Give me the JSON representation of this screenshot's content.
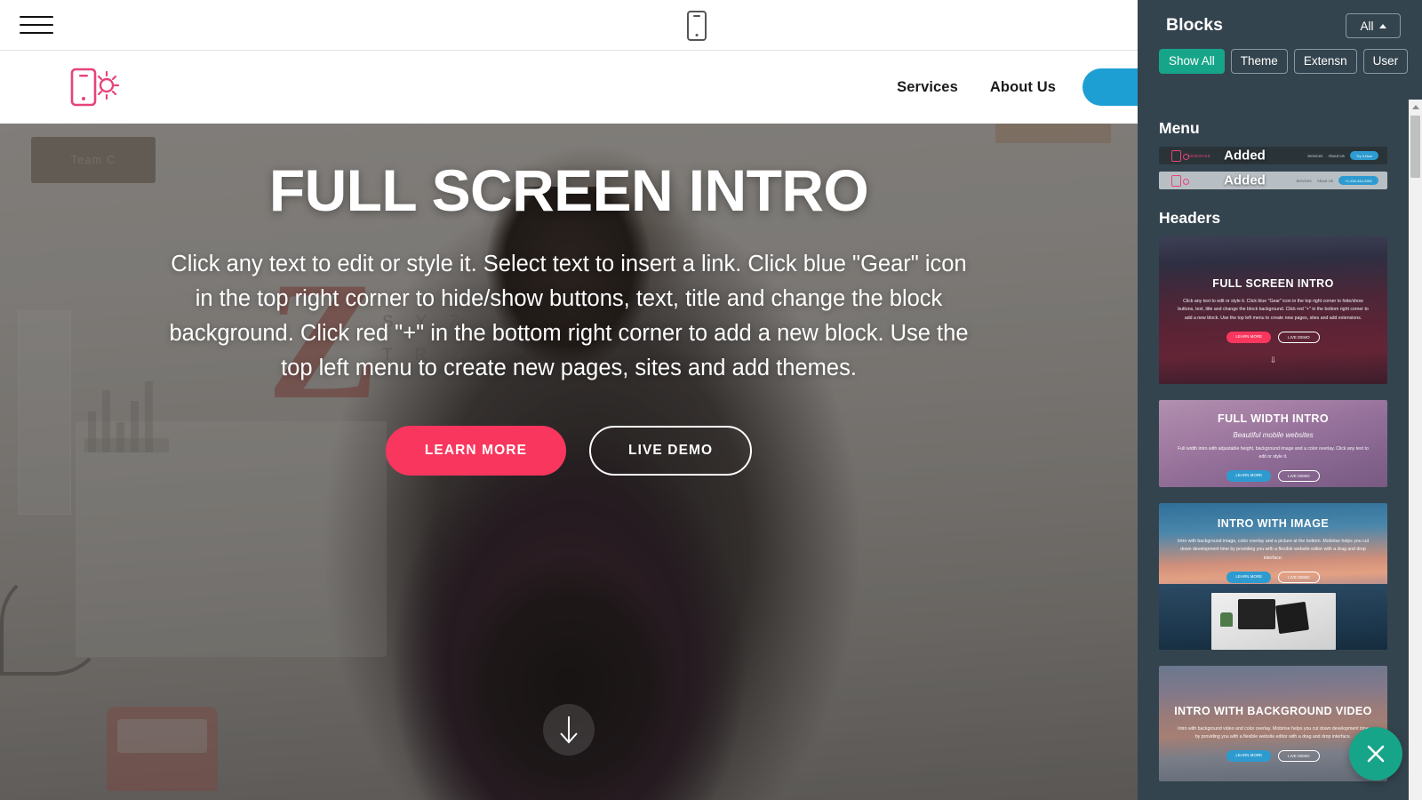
{
  "toolbar": {
    "menu_icon": "hamburger-menu-icon",
    "device_icon": "mobile-device-icon"
  },
  "site_navbar": {
    "logo_icon": "mobirise-phone-sun-logo",
    "links": [
      {
        "label": "Services"
      },
      {
        "label": "About Us"
      }
    ],
    "cta_color": "#1e9fd4"
  },
  "hero": {
    "title": "FULL SCREEN INTRO",
    "subtitle": "Click any text to edit or style it. Select text to insert a link. Click blue \"Gear\" icon in the top right corner to hide/show buttons, text, title and change the block background. Click red \"+\" in the bottom right corner to add a new block. Use the top left menu to create new pages, sites and add themes.",
    "buttons": [
      {
        "label": "LEARN MORE",
        "color": "#f8365e"
      },
      {
        "label": "LIVE DEMO",
        "color": "#ffffff"
      }
    ],
    "scroll_icon": "arrow-down-icon",
    "bg_letter": "Z",
    "bg_letters": "S Y Z I T R O",
    "bg_board_label": "Team C"
  },
  "panel": {
    "title": "Blocks",
    "filter": {
      "label": "All",
      "icon": "caret-up-icon"
    },
    "tabs": [
      {
        "label": "Show All",
        "active": true
      },
      {
        "label": "Theme",
        "active": false
      },
      {
        "label": "Extensn",
        "active": false
      },
      {
        "label": "User",
        "active": false
      }
    ],
    "accent_color": "#17a589",
    "background_color": "#34444e",
    "sections": [
      {
        "title": "Menu",
        "items": [
          {
            "status": "Added",
            "theme": "dark",
            "brand": "MOBIRISE",
            "links": [
              "Services",
              "About Us"
            ],
            "button": "Try It Now"
          },
          {
            "status": "Added",
            "theme": "light",
            "brand": "",
            "links": [
              "Services",
              "About Us"
            ],
            "button": "+1-234-444-2901"
          }
        ]
      },
      {
        "title": "Headers",
        "items": [
          {
            "title": "FULL SCREEN INTRO",
            "subtitle": "",
            "text": "Click any text to edit or style it. Click blue \"Gear\" icon in the top right corner to hide/show buttons, text, title and change the block background. Click red \"+\" in the bottom right corner to add a new block. Use the top left menu to create new pages, sites and add extensions.",
            "buttons": [
              "LEARN MORE",
              "LIVE DEMO"
            ],
            "arrow": "arrow-down-icon"
          },
          {
            "title": "FULL WIDTH INTRO",
            "subtitle": "Beautiful mobile websites",
            "text": "Full width intro with adjustable height, background image and a color overlay. Click any text to edit or style it.",
            "buttons": [
              "LEARN MORE",
              "LIVE DEMO"
            ],
            "arrow": ""
          },
          {
            "title": "INTRO WITH IMAGE",
            "subtitle": "",
            "text": "Intro with background image, color overlay and a picture at the bottom. Mobirise helps you cut down development time by providing you with a flexible website editor with a drag and drop interface.",
            "buttons": [
              "LEARN MORE",
              "LIVE DEMO"
            ],
            "arrow": ""
          },
          {
            "title": "INTRO WITH BACKGROUND VIDEO",
            "subtitle": "",
            "text": "Intro with background video and color overlay. Mobirise helps you cut down development time by providing you with a flexible website editor with a drag and drop interface.",
            "buttons": [
              "LEARN MORE",
              "LIVE DEMO"
            ],
            "arrow": ""
          }
        ]
      }
    ]
  },
  "fab": {
    "icon": "close-icon",
    "color": "#17a589"
  }
}
